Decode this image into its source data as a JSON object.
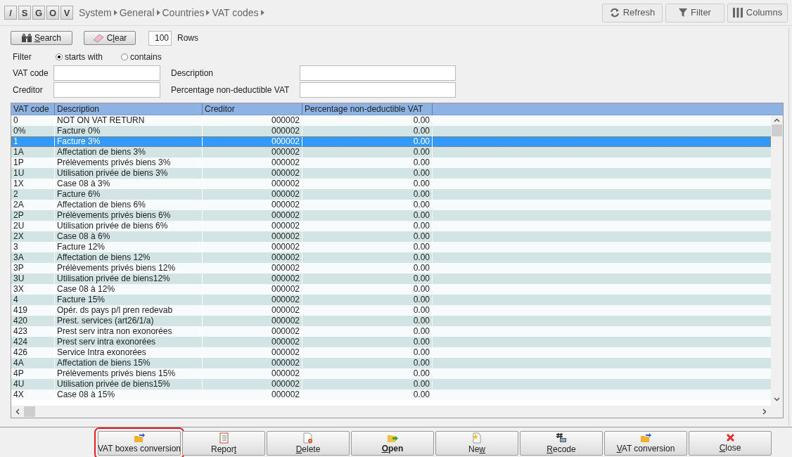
{
  "nav_buttons": [
    "/",
    "S",
    "G",
    "O",
    "V"
  ],
  "breadcrumb": [
    "System",
    "General",
    "Countries",
    "VAT codes"
  ],
  "toolbar": [
    {
      "kind": "refresh",
      "label": "Refresh"
    },
    {
      "kind": "filter",
      "label": "Filter"
    },
    {
      "kind": "columns",
      "label": "Columns"
    }
  ],
  "search_button": {
    "key": "S",
    "after": "earch"
  },
  "clear_button": {
    "before": "C",
    "key": "l",
    "after": "ear"
  },
  "rows_count": {
    "value": "100",
    "label": "Rows"
  },
  "filter": {
    "label": "Filter",
    "options": [
      {
        "label": "starts with",
        "selected": true
      },
      {
        "label": "contains",
        "selected": false
      }
    ]
  },
  "fields": [
    {
      "label": "VAT code"
    },
    {
      "label": "Description"
    },
    {
      "label": "Creditor"
    },
    {
      "label": "Percentage non-deductible VAT"
    }
  ],
  "table": {
    "columns": [
      "VAT code",
      "Description",
      "Creditor",
      "Percentage non-deductible VAT"
    ],
    "rows": [
      {
        "cells": [
          "0",
          "NOT ON VAT RETURN",
          "000002",
          "0.00"
        ],
        "selected": false
      },
      {
        "cells": [
          "0%",
          "Facture 0%",
          "000002",
          "0.00"
        ],
        "selected": false
      },
      {
        "cells": [
          "1",
          "Facture 3%",
          "000002",
          "0.00"
        ],
        "selected": true
      },
      {
        "cells": [
          "1A",
          "Affectation de biens 3%",
          "000002",
          "0.00"
        ],
        "selected": false
      },
      {
        "cells": [
          "1P",
          "Prélèvements privés biens 3%",
          "000002",
          "0.00"
        ],
        "selected": false
      },
      {
        "cells": [
          "1U",
          "Utilisation privée de biens 3%",
          "000002",
          "0.00"
        ],
        "selected": false
      },
      {
        "cells": [
          "1X",
          "Case 08 à 3%",
          "000002",
          "0.00"
        ],
        "selected": false
      },
      {
        "cells": [
          "2",
          "Facture 6%",
          "000002",
          "0.00"
        ],
        "selected": false
      },
      {
        "cells": [
          "2A",
          "Affectation de biens 6%",
          "000002",
          "0.00"
        ],
        "selected": false
      },
      {
        "cells": [
          "2P",
          "Prélèvements privés biens 6%",
          "000002",
          "0.00"
        ],
        "selected": false
      },
      {
        "cells": [
          "2U",
          "Utilisation privée de biens 6%",
          "000002",
          "0.00"
        ],
        "selected": false
      },
      {
        "cells": [
          "2X",
          "Case 08 à 6%",
          "000002",
          "0.00"
        ],
        "selected": false
      },
      {
        "cells": [
          "3",
          "Facture 12%",
          "000002",
          "0.00"
        ],
        "selected": false
      },
      {
        "cells": [
          "3A",
          "Affectation de biens 12%",
          "000002",
          "0.00"
        ],
        "selected": false
      },
      {
        "cells": [
          "3P",
          "Prélèvements privés biens 12%",
          "000002",
          "0.00"
        ],
        "selected": false
      },
      {
        "cells": [
          "3U",
          "Utilisation privée de biens12%",
          "000002",
          "0.00"
        ],
        "selected": false
      },
      {
        "cells": [
          "3X",
          "Case 08 à 12%",
          "000002",
          "0.00"
        ],
        "selected": false
      },
      {
        "cells": [
          "4",
          "Facture 15%",
          "000002",
          "0.00"
        ],
        "selected": false
      },
      {
        "cells": [
          "419",
          "Opér. ds pays p/l pren redevab",
          "000002",
          "0.00"
        ],
        "selected": false
      },
      {
        "cells": [
          "420",
          "Prest. services (art26/1/a)",
          "000002",
          "0.00"
        ],
        "selected": false
      },
      {
        "cells": [
          "423",
          "Prest serv intra non exonorées",
          "000002",
          "0.00"
        ],
        "selected": false
      },
      {
        "cells": [
          "424",
          "Prest serv intra exonorées",
          "000002",
          "0.00"
        ],
        "selected": false
      },
      {
        "cells": [
          "426",
          "Service Intra exonorées",
          "000002",
          "0.00"
        ],
        "selected": false
      },
      {
        "cells": [
          "4A",
          "Affectation de biens 15%",
          "000002",
          "0.00"
        ],
        "selected": false
      },
      {
        "cells": [
          "4P",
          "Prélèvements privés biens 15%",
          "000002",
          "0.00"
        ],
        "selected": false
      },
      {
        "cells": [
          "4U",
          "Utilisation privée de biens15%",
          "000002",
          "0.00"
        ],
        "selected": false
      },
      {
        "cells": [
          "4X",
          "Case 08 à 15%",
          "000002",
          "0.00"
        ],
        "selected": false
      }
    ]
  },
  "actions": [
    {
      "kind": "convert",
      "before": "VAT boxes conversion",
      "bold": false,
      "highlighted": true
    },
    {
      "kind": "report",
      "before": "Repor",
      "key": "t",
      "bold": false,
      "highlighted": false
    },
    {
      "kind": "delete",
      "key": "D",
      "after": "elete",
      "bold": false,
      "highlighted": false
    },
    {
      "kind": "open",
      "key": "O",
      "after": "pen",
      "bold": true,
      "highlighted": false
    },
    {
      "kind": "new",
      "before": "Ne",
      "key": "w",
      "bold": false,
      "highlighted": false
    },
    {
      "kind": "recode",
      "key": "R",
      "after": "ecode",
      "bold": false,
      "highlighted": false
    },
    {
      "kind": "convert",
      "key": "V",
      "after": "AT conversion",
      "bold": false,
      "highlighted": false
    },
    {
      "kind": "close",
      "key": "C",
      "after": "lose",
      "bold": false,
      "highlighted": false
    }
  ]
}
